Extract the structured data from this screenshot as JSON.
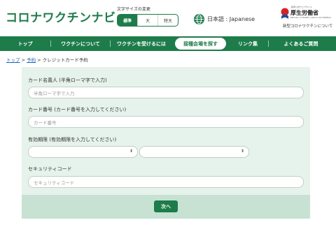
{
  "header": {
    "logo_text": "コロナワクチンナビ",
    "font_size": {
      "label": "文字サイズの変更",
      "options": [
        "標準",
        "大",
        "特大"
      ],
      "selected": "標準"
    },
    "language": "日本語 : Japanese",
    "ministry": {
      "small_text": "政府公式ウェブサイト",
      "name": "厚生労働省",
      "english": "Ministry of Health, Labour and Welfare",
      "subtitle": "新型コロナワクチンについて"
    }
  },
  "nav": {
    "items": [
      "トップ",
      "ワクチンについて",
      "ワクチンを受けるには",
      "接種会場を探す",
      "リンク集",
      "よくあるご質問"
    ],
    "active": "接種会場を探す"
  },
  "breadcrumb": {
    "items": [
      "トップ",
      "予約",
      "クレジットカード予約"
    ],
    "separator": " > "
  },
  "form": {
    "card_name": {
      "label": "カード名義人 (半角ローマ字で入力)",
      "placeholder": "半角ローマ字で入力",
      "value": ""
    },
    "card_number": {
      "label": "カード番号 (カード番号を入力してください)",
      "placeholder": "カード番号",
      "value": ""
    },
    "expiry": {
      "label": "有効期限 (有効期限を入力してください)",
      "month_value": "",
      "year_value": ""
    },
    "security_code": {
      "label": "セキュリティコード",
      "placeholder": "セキュリティコード",
      "value": ""
    },
    "next_label": "次へ"
  },
  "colors": {
    "brand_green": "#1d7c4a",
    "panel_bg": "#e6f2ec",
    "footer_bg": "#c7e1d3",
    "link_blue": "#1d64b5"
  }
}
